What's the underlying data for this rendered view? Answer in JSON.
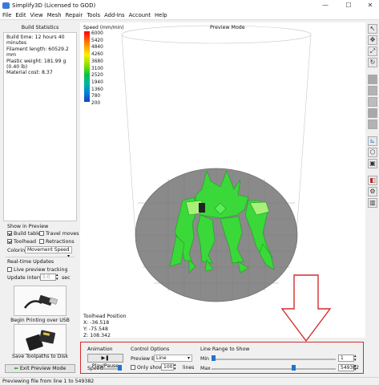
{
  "window": {
    "title": "Simplify3D (Licensed to GOD)",
    "minimize": "—",
    "maximize": "☐",
    "close": "✕"
  },
  "menu": [
    "File",
    "Edit",
    "View",
    "Mesh",
    "Repair",
    "Tools",
    "Add-Ins",
    "Account",
    "Help"
  ],
  "build_statistics": {
    "header": "Build Statistics",
    "lines": [
      "Build time: 12 hours 40 minutes",
      "Filament length: 60529.2 mm",
      "Plastic weight: 181.99 g (0.40 lb)",
      "Material cost: 8.37"
    ]
  },
  "show_in_preview": {
    "header": "Show in Preview",
    "build_table": "Build table",
    "travel_moves": "Travel moves",
    "toolhead": "Toolhead",
    "retractions": "Retractions",
    "coloring_label": "Coloring",
    "coloring_value": "Movement Speed"
  },
  "realtime": {
    "header": "Real-time Updates",
    "live_preview": "Live preview tracking",
    "interval_label": "Update interval",
    "interval_value": "5.0",
    "interval_unit": "sec"
  },
  "buttons": {
    "usb": "Begin Printing over USB",
    "save": "Save Toolpaths to Disk",
    "exit": "Exit Preview Mode"
  },
  "viewport": {
    "mode": "Preview Mode",
    "legend_title": "Speed (mm/min)",
    "legend": [
      "6000",
      "5420",
      "4840",
      "4260",
      "3680",
      "3100",
      "2520",
      "1940",
      "1360",
      "780",
      "200"
    ],
    "toolhead_title": "Toolhead Position",
    "x": "X: -36.518",
    "y": "Y: -75.548",
    "z": "Z: 108.342"
  },
  "controls": {
    "animation": "Animation",
    "play": "Play/Pause",
    "speed": "Speed:",
    "control_options": "Control Options",
    "preview_by": "Preview By",
    "preview_by_value": "Line",
    "only_show": "Only show",
    "only_show_value": "100",
    "lines": "lines",
    "line_range": "Line Range to Show",
    "min": "Min",
    "max": "Max",
    "min_value": "1",
    "max_value": "549382"
  },
  "status": "Previewing file from line 1 to 549382",
  "colors": {
    "accent": "#1e73d2",
    "highlight_border": "#d52b2b",
    "model": "#3bd83a",
    "bed": "#8a8a8a"
  }
}
